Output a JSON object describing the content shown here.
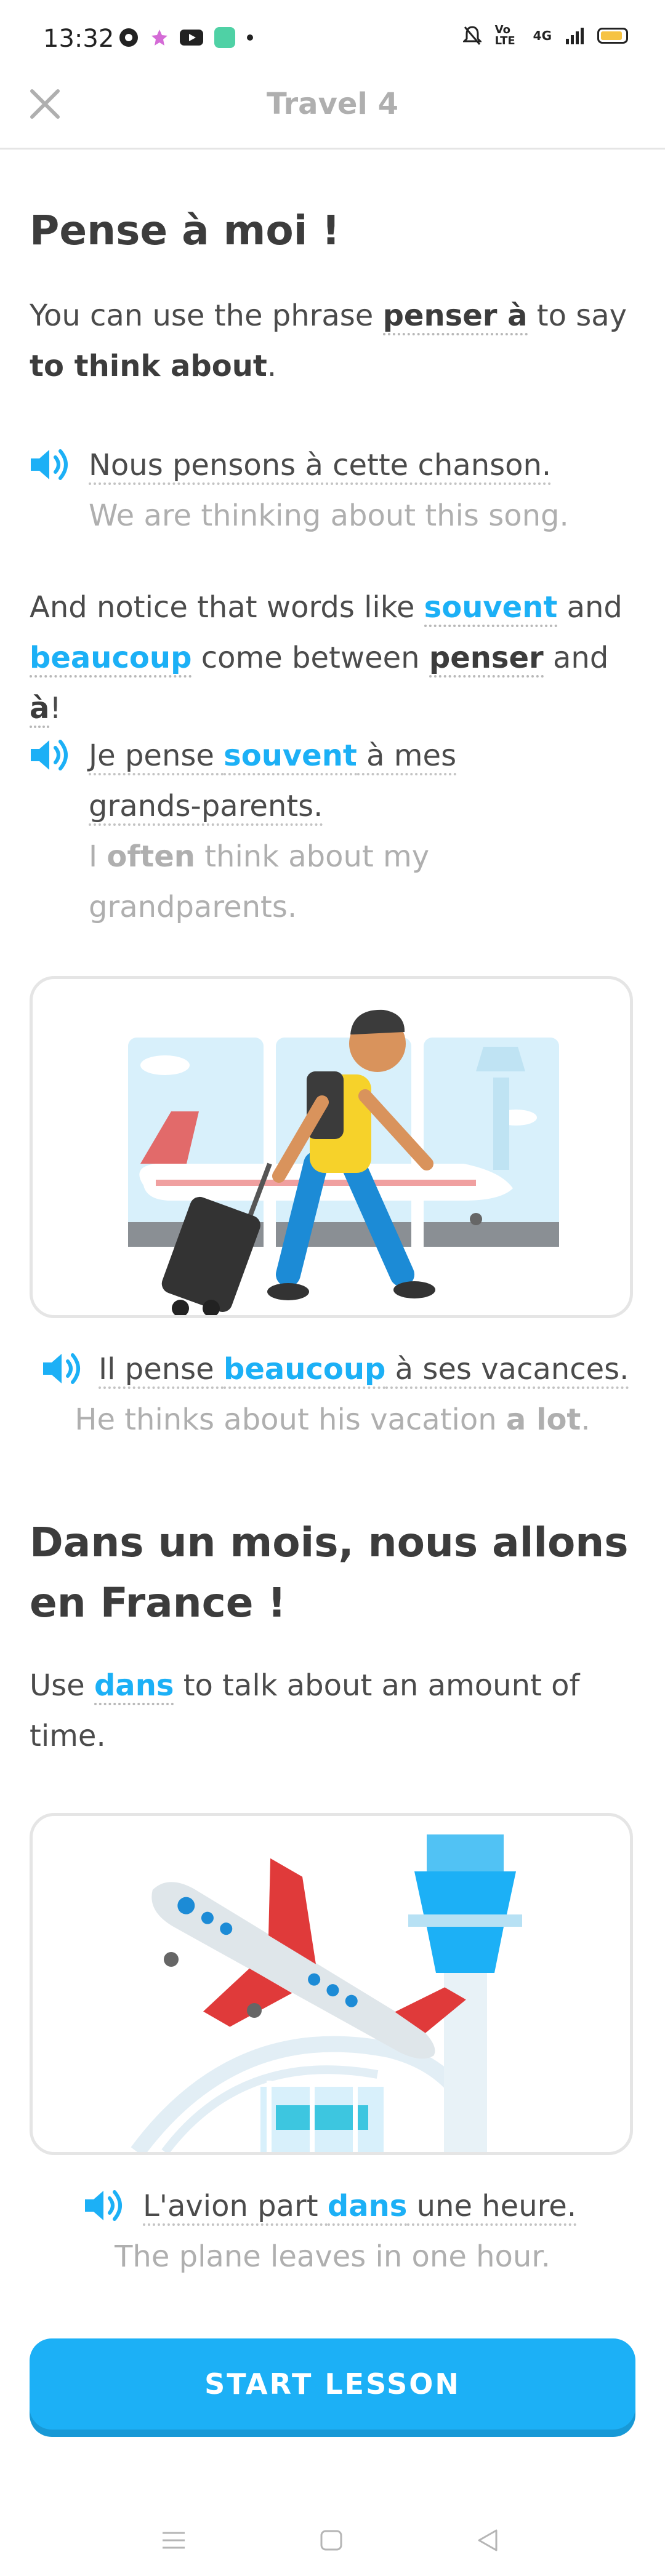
{
  "status_bar": {
    "time": "13:32",
    "network": "4G",
    "volte": "Vo LTE"
  },
  "header": {
    "title": "Travel 4"
  },
  "section1": {
    "heading": "Pense à moi !",
    "intro": {
      "t1": "You can use the phrase ",
      "phrase": "penser à",
      "t2": " to say ",
      "meaning": "to think about",
      "t3": "."
    },
    "example1": {
      "french": "Nous pensons à cette chanson.",
      "english": "We are thinking about this song."
    },
    "notice": {
      "t1": "And notice that words like ",
      "w1": "souvent",
      "t2": " and ",
      "w2": "beaucoup",
      "t3": " come between ",
      "w3": "penser",
      "t4": " and ",
      "w4": "à",
      "t5": "!"
    },
    "example2": {
      "fr1": "Je pense ",
      "fr_highlight": "souvent",
      "fr2": " à mes grands-parents.",
      "en1": "I ",
      "en_highlight": "often",
      "en2": " think about my grandparents."
    },
    "example3": {
      "fr1": "Il pense ",
      "fr_highlight": "beaucoup",
      "fr2": " à ses vacances.",
      "en1": "He thinks about his vacation ",
      "en_highlight": "a lot",
      "en2": "."
    }
  },
  "section2": {
    "heading": "Dans un mois, nous allons en France !",
    "intro": {
      "t1": "Use ",
      "word": "dans",
      "t2": " to talk about an amount of time."
    },
    "example": {
      "fr1": "L'avion part ",
      "fr_highlight": "dans",
      "fr2": " une heure.",
      "english": "The plane leaves in one hour."
    }
  },
  "start_button": {
    "label": "START LESSON"
  },
  "colors": {
    "accent": "#1cb0f6",
    "accent_shadow": "#1899d6",
    "muted": "#afafaf",
    "text": "#4b4b4b"
  },
  "icons": [
    "close-icon",
    "speaker-icon",
    "menu-icon",
    "home-icon",
    "back-icon"
  ]
}
